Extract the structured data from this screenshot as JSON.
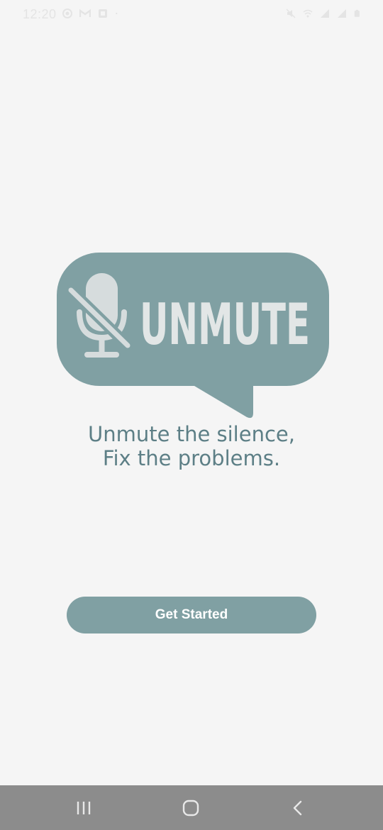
{
  "status_bar": {
    "time": "12:20",
    "left_icons": [
      "shield-icon",
      "gmail-icon",
      "notification-app-icon",
      "dot-icon"
    ],
    "right_icons": [
      "mute-icon",
      "wifi-icon",
      "signal-icon",
      "signal-icon",
      "battery-icon"
    ]
  },
  "logo": {
    "text": "UNMUTE",
    "icon": "muted-microphone-icon"
  },
  "tagline": {
    "line1": "Unmute the silence,",
    "line2": "Fix the problems."
  },
  "actions": {
    "get_started_label": "Get Started"
  },
  "nav_bar": {
    "buttons": [
      "recent-apps-icon",
      "home-icon",
      "back-icon"
    ]
  },
  "colors": {
    "background": "#f5f5f5",
    "accent": "#80a0a3",
    "tagline": "#5d7f86",
    "logo_text": "#e2e6e6",
    "nav_bar": "#8c8c8c"
  }
}
